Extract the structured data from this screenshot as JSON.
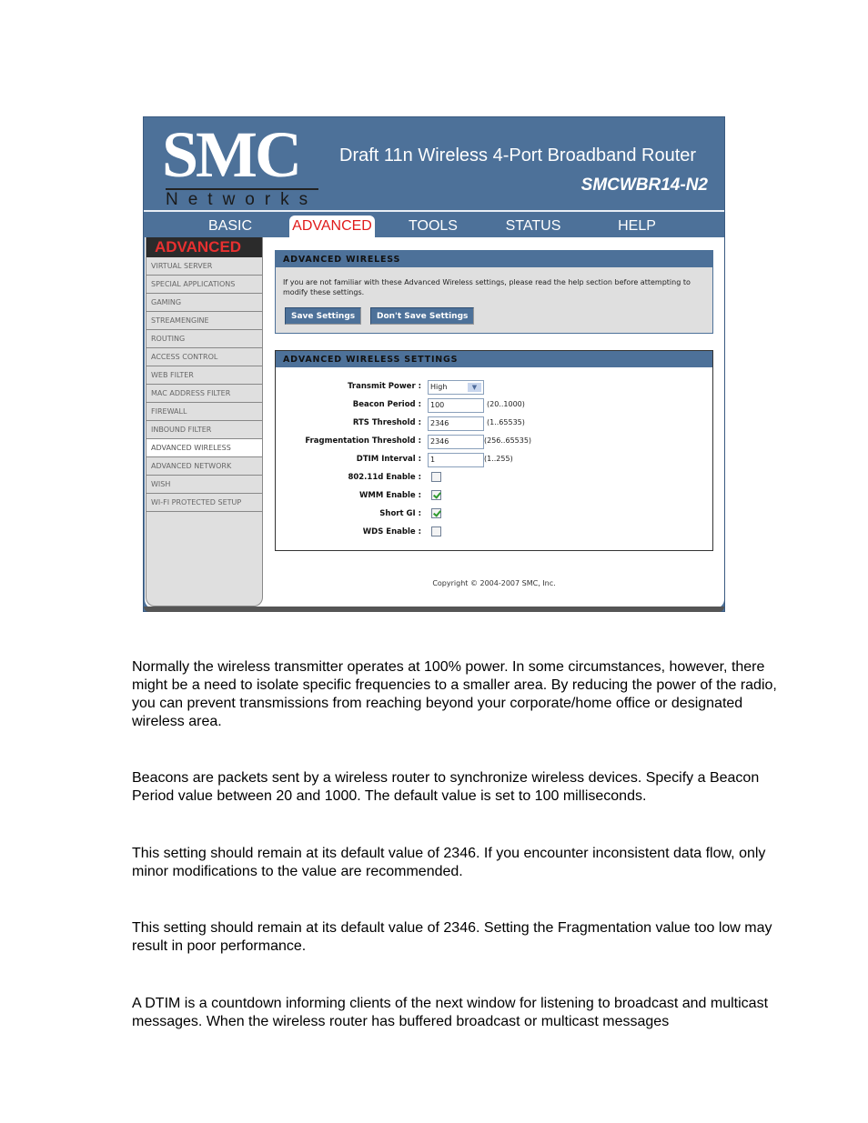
{
  "router_ui": {
    "logo": {
      "brand": "SMC",
      "subtitle": "Networks"
    },
    "product_title": "Draft 11n Wireless 4-Port Broadband Router",
    "product_model": "SMCWBR14-N2",
    "nav_tabs": [
      {
        "label": "BASIC",
        "active": false
      },
      {
        "label": "ADVANCED",
        "active": true
      },
      {
        "label": "TOOLS",
        "active": false
      },
      {
        "label": "STATUS",
        "active": false
      },
      {
        "label": "HELP",
        "active": false
      }
    ],
    "sidebar": {
      "title": "ADVANCED",
      "items": [
        {
          "label": "VIRTUAL SERVER",
          "active": false
        },
        {
          "label": "SPECIAL APPLICATIONS",
          "active": false
        },
        {
          "label": "GAMING",
          "active": false
        },
        {
          "label": "STREAMENGINE",
          "active": false
        },
        {
          "label": "ROUTING",
          "active": false
        },
        {
          "label": "ACCESS CONTROL",
          "active": false
        },
        {
          "label": "WEB FILTER",
          "active": false
        },
        {
          "label": "MAC ADDRESS FILTER",
          "active": false
        },
        {
          "label": "FIREWALL",
          "active": false
        },
        {
          "label": "INBOUND FILTER",
          "active": false
        },
        {
          "label": "ADVANCED WIRELESS",
          "active": true
        },
        {
          "label": "ADVANCED NETWORK",
          "active": false
        },
        {
          "label": "WISH",
          "active": false
        },
        {
          "label": "WI-FI PROTECTED SETUP",
          "active": false
        }
      ]
    },
    "intro_panel": {
      "title": "ADVANCED WIRELESS",
      "description": "If you are not familiar with these Advanced Wireless settings, please read the help section before attempting to modify these settings.",
      "save_label": "Save Settings",
      "dont_save_label": "Don't Save Settings"
    },
    "settings_panel": {
      "title": "ADVANCED WIRELESS SETTINGS",
      "transmit_power": {
        "label": "Transmit Power :",
        "value": "High"
      },
      "beacon_period": {
        "label": "Beacon Period :",
        "value": "100",
        "hint": "(20..1000)"
      },
      "rts_threshold": {
        "label": "RTS Threshold :",
        "value": "2346",
        "hint": "(1..65535)"
      },
      "fragmentation_threshold": {
        "label": "Fragmentation Threshold :",
        "value": "2346",
        "hint": "(256..65535)"
      },
      "dtim_interval": {
        "label": "DTIM Interval :",
        "value": "1",
        "hint": "(1..255)"
      },
      "dot11d_enable": {
        "label": "802.11d Enable :",
        "checked": false
      },
      "wmm_enable": {
        "label": "WMM Enable :",
        "checked": true
      },
      "short_gi": {
        "label": "Short GI :",
        "checked": true
      },
      "wds_enable": {
        "label": "WDS Enable :",
        "checked": false
      }
    },
    "copyright": "Copyright © 2004-2007 SMC, Inc."
  },
  "document_paragraphs": [
    "Normally the wireless transmitter operates at 100% power. In some circumstances, however, there might be a need to isolate specific frequencies to a smaller area. By reducing the power of the radio, you can prevent transmissions from reaching beyond your corporate/home office or designated wireless area.",
    "Beacons are packets sent by a wireless router to synchronize wireless devices. Specify a Beacon Period value between 20 and 1000. The default value is set to 100 milliseconds.",
    "This setting should remain at its default value of 2346. If you encounter inconsistent data flow, only minor modifications to the value are recommended.",
    "This setting should remain at its default value of 2346. Setting the Fragmentation value too low may result in poor performance.",
    "A DTIM is a countdown informing clients of the next window for listening to broadcast and multicast messages. When the wireless router has buffered broadcast or multicast messages"
  ],
  "colors": {
    "brand_blue": "#4d7199",
    "active_tab_red": "#e01b1b",
    "sidebar_bg": "#dfdfdf",
    "check_green": "#2e9a2e"
  }
}
